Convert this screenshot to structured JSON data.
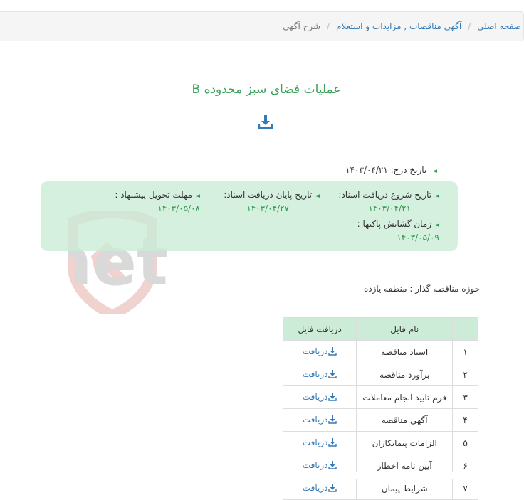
{
  "breadcrumb": {
    "home": "صفحه اصلی",
    "section": "آگهی مناقصات , مزایدات و استعلام",
    "current": "شرح آگهی"
  },
  "title": "عملیات فضای سبز محدوده B",
  "download_icon": "download-icon",
  "watermark_text": "AriaTender.net",
  "dates": {
    "insert_label": "تاریخ درج:",
    "insert_value": "۱۴۰۳/۰۴/۲۱",
    "start_label": "تاریخ شروع دریافت اسناد:",
    "start_value": "۱۴۰۳/۰۴/۲۱",
    "end_label": "تاریخ پایان دریافت اسناد:",
    "end_value": "۱۴۰۳/۰۴/۲۷",
    "deadline_label": "مهلت تحویل پیشنهاد :",
    "deadline_value": "۱۴۰۳/۰۵/۰۸",
    "opening_label": "زمان گشایش پاکتها :",
    "opening_value": "۱۴۰۳/۰۵/۰۹"
  },
  "authority": "حوزه مناقصه گذار : منطقه یازده",
  "table": {
    "headers": [
      "",
      "نام فایل",
      "دریافت فایل"
    ],
    "download_label": "دریافت",
    "rows": [
      {
        "num": "۱",
        "name": "اسناد مناقصه"
      },
      {
        "num": "۲",
        "name": "برآورد مناقصه"
      },
      {
        "num": "۳",
        "name": "فرم تایید انجام معاملات"
      },
      {
        "num": "۴",
        "name": "آگهی مناقصه"
      },
      {
        "num": "۵",
        "name": "الزامات پیمانکاران"
      },
      {
        "num": "۶",
        "name": "آیین نامه اخطار"
      },
      {
        "num": "۷",
        "name": "شرایط پیمان"
      }
    ]
  },
  "colors": {
    "accent_green": "#2e9a4f",
    "title_green": "#3aa05a",
    "link_blue": "#337ab7",
    "info_bg": "#caecd6"
  }
}
